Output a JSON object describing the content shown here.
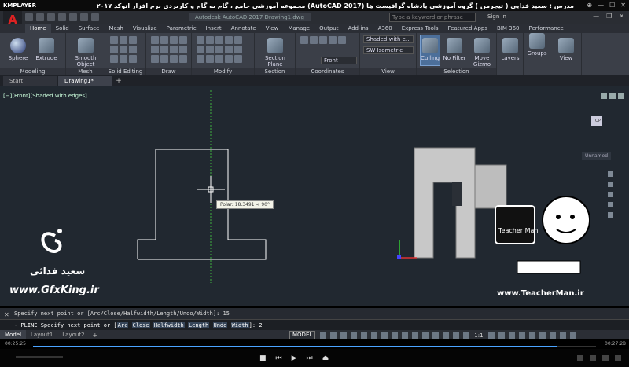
{
  "player": {
    "logo": "KMPLAYER",
    "title": "مجموعه آموزشی جامع ، گام به گام و کاربردی نرم افزار اتوکد ۲۰۱۷ (AutoCAD 2017) مدرس : سعید فدایی ( تیچرمن ) گروه آموزشی پادشاه گرافیست ها",
    "time_current": "00:25:25",
    "time_total": "00:27:28",
    "progress": 0.93
  },
  "acad": {
    "app_letter": "A",
    "doc_title": "Autodesk AutoCAD 2017   Drawing1.dwg",
    "search_placeholder": "Type a keyword or phrase",
    "signin": "Sign In"
  },
  "ribbon_tabs": [
    "Home",
    "Solid",
    "Surface",
    "Mesh",
    "Visualize",
    "Parametric",
    "Insert",
    "Annotate",
    "View",
    "Manage",
    "Output",
    "Add-ins",
    "A360",
    "Express Tools",
    "Featured Apps",
    "BIM 360",
    "Performance"
  ],
  "ribbon": {
    "sphere": "Sphere",
    "extrude": "Extrude",
    "smooth_object": "Smooth Object",
    "section_plane": "Section Plane",
    "culling": "Culling",
    "no_filter": "No Filter",
    "move_gizmo": "Move Gizmo",
    "layers": "Layers",
    "groups": "Groups",
    "view": "View",
    "visual_style": "Shaded with e...",
    "view_preset": "SW Isometric",
    "ucs": "Front",
    "panels": {
      "modeling": "Modeling",
      "mesh": "Mesh",
      "solid_editing": "Solid Editing",
      "draw": "Draw",
      "modify": "Modify",
      "section": "Section",
      "coordinates": "Coordinates",
      "view": "View",
      "selection": "Selection"
    }
  },
  "file_tabs": [
    "Start",
    "Drawing1*"
  ],
  "viewport": {
    "label": "[−][Front][Shaded with edges]",
    "viewcube": "TOP",
    "unnamed": "Unnamed",
    "polar": "Polar: 18.3491 < 90°"
  },
  "watermark": {
    "name": "سعید فدائی",
    "site_left": "www.GfxKing.ir",
    "site_right": "www.TeacherMan.ir",
    "teacherman": "Teacher Man"
  },
  "command": {
    "history": "Specify next point or [Arc/Close/Halfwidth/Length/Undo/Width]: 15",
    "prompt_prefix": "- PLINE Specify next point or [",
    "options": [
      "Arc",
      "Close",
      "Halfwidth",
      "Length",
      "Undo",
      "Width"
    ],
    "prompt_suffix": "]:",
    "input": "2"
  },
  "layout_tabs": [
    "Model",
    "Layout1",
    "Layout2"
  ],
  "status": {
    "model": "MODEL",
    "scale": "1:1"
  }
}
